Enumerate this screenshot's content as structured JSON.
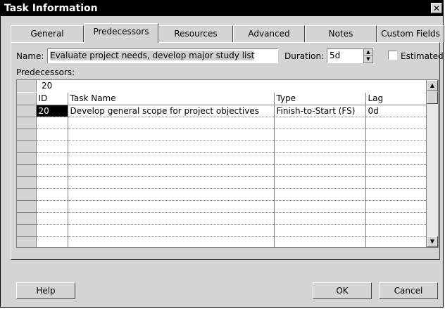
{
  "window": {
    "title": "Task Information",
    "close_glyph": "✕"
  },
  "tabs": [
    {
      "label": "General"
    },
    {
      "label": "Predecessors",
      "active": true
    },
    {
      "label": "Resources"
    },
    {
      "label": "Advanced"
    },
    {
      "label": "Notes"
    },
    {
      "label": "Custom Fields"
    }
  ],
  "form": {
    "name_label": "Name:",
    "name_value": "Evaluate project needs, develop major study list",
    "duration_label": "Duration:",
    "duration_value": "5d",
    "estimated_label": "Estimated",
    "estimated_checked": false
  },
  "predecessors": {
    "label": "Predecessors:",
    "edit_value": "20",
    "columns": [
      "ID",
      "Task Name",
      "Type",
      "Lag"
    ],
    "rows": [
      {
        "id": "20",
        "task_name": "Develop general scope for project objectives",
        "type": "Finish-to-Start (FS)",
        "lag": "0d"
      }
    ]
  },
  "buttons": {
    "help": "Help",
    "ok": "OK",
    "cancel": "Cancel"
  }
}
